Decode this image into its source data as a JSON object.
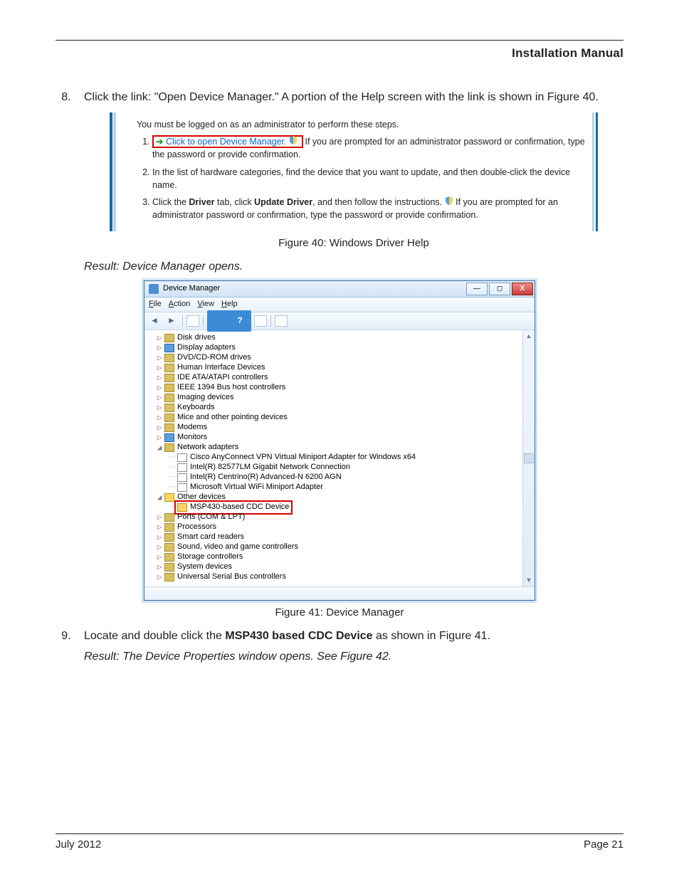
{
  "header": {
    "title": "Installation Manual"
  },
  "step8": {
    "num": "8.",
    "text": "Click the link: \"Open Device Manager.\" A portion of the Help screen with the link is shown in Figure 40."
  },
  "help": {
    "intro": "You must be logged on as an administrator to perform these steps.",
    "items": [
      {
        "link": "Click to open Device Manager.",
        "after": " If you are prompted for an administrator password or confirmation, type the password or provide confirmation."
      },
      {
        "plain": "In the list of hardware categories, find the device that you want to update, and then double-click the device name."
      },
      {
        "pre": "Click the ",
        "b1": "Driver",
        "mid1": " tab, click ",
        "b2": "Update Driver",
        "mid2": ", and then follow the instructions. ",
        "after": " If you are prompted for an administrator password or confirmation, type the password or provide confirmation."
      }
    ]
  },
  "fig40": "Figure 40:  Windows Driver Help",
  "result1": "Result: Device Manager opens.",
  "dm": {
    "title": "Device Manager",
    "menu": {
      "file": "File",
      "action": "Action",
      "view": "View",
      "help": "Help"
    },
    "tree": [
      {
        "lvl": 1,
        "exp": "▷",
        "label": "Disk drives",
        "ic": "def"
      },
      {
        "lvl": 1,
        "exp": "▷",
        "label": "Display adapters",
        "ic": "mon"
      },
      {
        "lvl": 1,
        "exp": "▷",
        "label": "DVD/CD-ROM drives",
        "ic": "def"
      },
      {
        "lvl": 1,
        "exp": "▷",
        "label": "Human Interface Devices",
        "ic": "def"
      },
      {
        "lvl": 1,
        "exp": "▷",
        "label": "IDE ATA/ATAPI controllers",
        "ic": "def"
      },
      {
        "lvl": 1,
        "exp": "▷",
        "label": "IEEE 1394 Bus host controllers",
        "ic": "def"
      },
      {
        "lvl": 1,
        "exp": "▷",
        "label": "Imaging devices",
        "ic": "def"
      },
      {
        "lvl": 1,
        "exp": "▷",
        "label": "Keyboards",
        "ic": "def"
      },
      {
        "lvl": 1,
        "exp": "▷",
        "label": "Mice and other pointing devices",
        "ic": "def"
      },
      {
        "lvl": 1,
        "exp": "▷",
        "label": "Modems",
        "ic": "def"
      },
      {
        "lvl": 1,
        "exp": "▷",
        "label": "Monitors",
        "ic": "mon"
      },
      {
        "lvl": 1,
        "exp": "◢",
        "label": "Network adapters",
        "ic": "net"
      },
      {
        "lvl": 2,
        "exp": "",
        "label": "Cisco AnyConnect VPN Virtual Miniport Adapter for Windows x64",
        "ic": "netc"
      },
      {
        "lvl": 2,
        "exp": "",
        "label": "Intel(R) 82577LM Gigabit Network Connection",
        "ic": "netc"
      },
      {
        "lvl": 2,
        "exp": "",
        "label": "Intel(R) Centrino(R) Advanced-N 6200 AGN",
        "ic": "netc"
      },
      {
        "lvl": 2,
        "exp": "",
        "label": "Microsoft Virtual WiFi Miniport Adapter",
        "ic": "netc"
      },
      {
        "lvl": 1,
        "exp": "◢",
        "label": "Other devices",
        "ic": "warn"
      },
      {
        "lvl": 2,
        "exp": "",
        "label": "MSP430-based CDC Device",
        "ic": "warn",
        "hl": true
      },
      {
        "lvl": 1,
        "exp": "▷",
        "label": "Ports (COM & LPT)",
        "ic": "def"
      },
      {
        "lvl": 1,
        "exp": "▷",
        "label": "Processors",
        "ic": "def"
      },
      {
        "lvl": 1,
        "exp": "▷",
        "label": "Smart card readers",
        "ic": "def"
      },
      {
        "lvl": 1,
        "exp": "▷",
        "label": "Sound, video and game controllers",
        "ic": "def"
      },
      {
        "lvl": 1,
        "exp": "▷",
        "label": "Storage controllers",
        "ic": "def"
      },
      {
        "lvl": 1,
        "exp": "▷",
        "label": "System devices",
        "ic": "def"
      },
      {
        "lvl": 1,
        "exp": "▷",
        "label": "Universal Serial Bus controllers",
        "ic": "def"
      }
    ]
  },
  "fig41": "Figure 41:  Device Manager",
  "step9": {
    "num": "9.",
    "pre": "Locate and double click the ",
    "bold": "MSP430 based CDC Device",
    "post": " as shown in Figure 41."
  },
  "result2": "Result: The Device Properties window opens. See Figure 42.",
  "footer": {
    "left": "July 2012",
    "right": "Page 21"
  }
}
